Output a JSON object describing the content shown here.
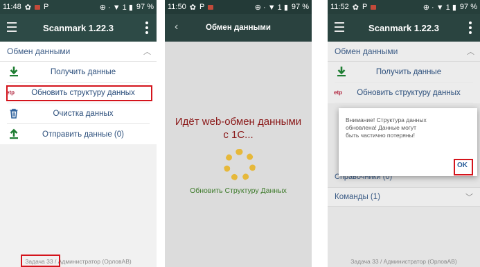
{
  "phone1": {
    "status": {
      "time": "11:48",
      "battery": "97 %",
      "signal": "⊕ · ▼ 1 ▮"
    },
    "app_title": "Scanmark 1.22.3",
    "section_title": "Обмен данными",
    "items": [
      {
        "label": "Получить данные"
      },
      {
        "label": "Обновить структуру данных"
      },
      {
        "label": "Очистка данных"
      },
      {
        "label": "Отправить данные (0)"
      }
    ],
    "footer": "Задача 33 / Администратор (ОрловАВ)"
  },
  "phone2": {
    "status": {
      "time": "11:50",
      "battery": "97 %",
      "signal": "⊕ · ▼ 1 ▮"
    },
    "app_title": "Обмен данными",
    "message": "Идёт web-обмен данными с 1С...",
    "caption": "Обновить Структуру Данных"
  },
  "phone3": {
    "status": {
      "time": "11:52",
      "battery": "97 %",
      "signal": "⊕ · ▼ 1 ▮"
    },
    "app_title": "Scanmark 1.22.3",
    "section_title": "Обмен данными",
    "items": [
      {
        "label": "Получить данные"
      },
      {
        "label": "Обновить структуру данных"
      }
    ],
    "partial_row": "Справочники (0)",
    "commands": "Команды (1)",
    "dialog_text": "Внимание! Структура данных обновлена! Данные могут быть частично потеряны!",
    "ok_label": "OK",
    "footer": "Задача 33 / Администратор (ОрловАВ)"
  },
  "colors": {
    "header": "#2d4a46",
    "status": "#28433f",
    "highlight": "#d4141c",
    "link": "#2c4f7c",
    "spinner": "#e6b83a"
  }
}
